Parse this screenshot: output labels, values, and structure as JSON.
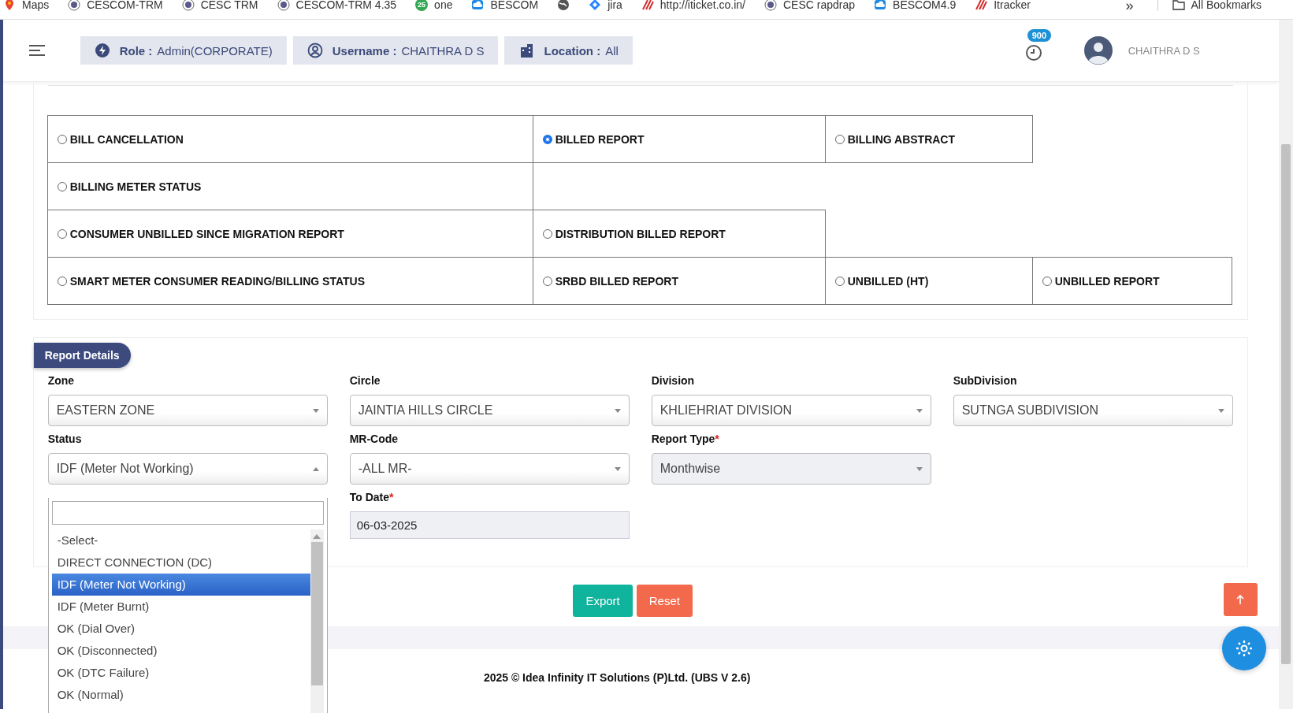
{
  "bookmarks": [
    {
      "kind": "maps",
      "label": "Maps"
    },
    {
      "kind": "logo",
      "label": "CESCOM-TRM"
    },
    {
      "kind": "logo",
      "label": "CESC TRM"
    },
    {
      "kind": "logo",
      "label": "CESCOM-TRM 4.35"
    },
    {
      "kind": "badge",
      "badge": "25",
      "label": "one"
    },
    {
      "kind": "cloud",
      "label": "BESCOM"
    },
    {
      "kind": "globe"
    },
    {
      "kind": "jira",
      "label": "jira"
    },
    {
      "kind": "stripes",
      "label": "http://iticket.co.in/"
    },
    {
      "kind": "logo",
      "label": "CESC rapdrap"
    },
    {
      "kind": "cloud",
      "label": "BESCOM4.9"
    },
    {
      "kind": "stripes",
      "label": "Itracker"
    }
  ],
  "bookmarks_more": "»",
  "all_bookmarks": "All Bookmarks",
  "header": {
    "chips": [
      {
        "kind": "role",
        "label": "Role :",
        "value": "Admin(CORPORATE)"
      },
      {
        "kind": "user",
        "label": "Username :",
        "value": "CHAITHRA D S"
      },
      {
        "kind": "location",
        "label": "Location :",
        "value": "All"
      }
    ],
    "notification_count": "900",
    "user_name": "CHAITHRA D S"
  },
  "report_types": [
    [
      {
        "label": "BILL CANCELLATION",
        "selected": false
      },
      {
        "label": "BILLED REPORT",
        "selected": true
      },
      {
        "label": "BILLING ABSTRACT",
        "selected": false
      }
    ],
    [
      {
        "label": "BILLING METER STATUS",
        "selected": false
      }
    ],
    [
      {
        "label": "CONSUMER UNBILLED SINCE MIGRATION REPORT",
        "selected": false
      },
      {
        "label": "DISTRIBUTION BILLED REPORT",
        "selected": false
      }
    ],
    [
      {
        "label": "SMART METER CONSUMER READING/BILLING STATUS",
        "selected": false
      },
      {
        "label": "SRBD BILLED REPORT",
        "selected": false
      },
      {
        "label": "UNBILLED (HT)",
        "selected": false
      },
      {
        "label": "UNBILLED REPORT",
        "selected": false
      }
    ]
  ],
  "report_details": {
    "title": "Report Details",
    "fields": [
      {
        "kind": "select",
        "label": "Zone",
        "value": "EASTERN ZONE"
      },
      {
        "kind": "select",
        "label": "Circle",
        "value": "JAINTIA HILLS CIRCLE"
      },
      {
        "kind": "select",
        "label": "Division",
        "value": "KHLIEHRIAT DIVISION"
      },
      {
        "kind": "select",
        "label": "SubDivision",
        "value": "SUTNGA SUBDIVISION"
      },
      {
        "kind": "select",
        "label": "Status",
        "value": "IDF (Meter Not Working)",
        "expanded": true
      },
      {
        "kind": "select",
        "label": "MR-Code",
        "value": "-ALL MR-"
      },
      {
        "kind": "select",
        "label": "Report Type",
        "required_mark": "*",
        "value": "Monthwise",
        "disabled": true
      },
      {
        "kind": "date",
        "label": "To Date",
        "required_mark": "*",
        "value": "06-03-2025"
      }
    ],
    "status_options": [
      {
        "label": "-Select-",
        "selected": false
      },
      {
        "label": "DIRECT CONNECTION (DC)",
        "selected": false
      },
      {
        "label": "IDF (Meter Not Working)",
        "selected": true
      },
      {
        "label": "IDF (Meter Burnt)",
        "selected": false
      },
      {
        "label": "OK (Dial Over)",
        "selected": false
      },
      {
        "label": "OK (Disconnected)",
        "selected": false
      },
      {
        "label": "OK (DTC Failure)",
        "selected": false
      },
      {
        "label": "OK (Normal)",
        "selected": false
      }
    ]
  },
  "buttons": [
    {
      "kind": "export",
      "label": "Export"
    },
    {
      "kind": "reset",
      "label": "Reset"
    }
  ],
  "footer": "2025 © Idea Infinity IT Solutions (P)Ltd. (UBS V 2.6)"
}
